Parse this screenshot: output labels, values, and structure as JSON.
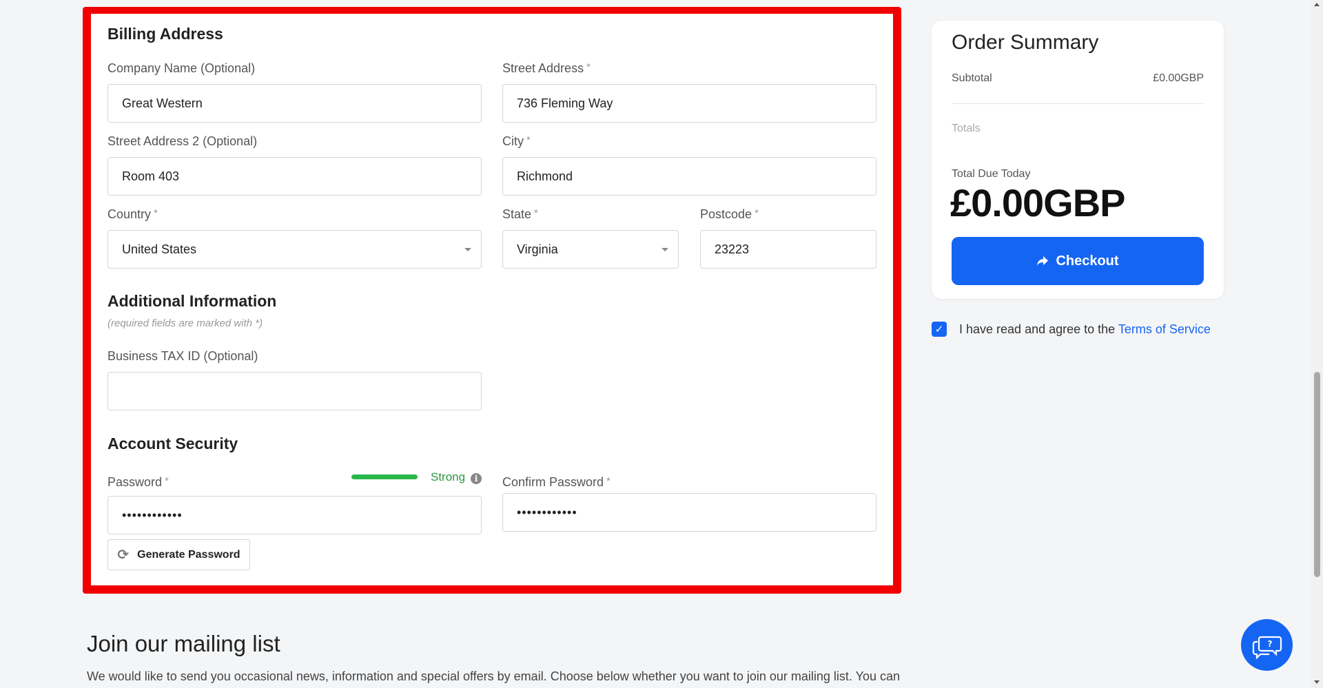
{
  "billing": {
    "title": "Billing Address",
    "company_label": "Company Name (Optional)",
    "company_value": "Great Western",
    "street_label": "Street Address",
    "street_value": "736 Fleming Way",
    "street2_label": "Street Address 2 (Optional)",
    "street2_value": "Room 403",
    "city_label": "City",
    "city_value": "Richmond",
    "country_label": "Country",
    "country_value": "United States",
    "state_label": "State",
    "state_value": "Virginia",
    "postcode_label": "Postcode",
    "postcode_value": "23223",
    "required_mark": "*"
  },
  "additional": {
    "title": "Additional Information",
    "hint": "(required fields are marked with *)",
    "tax_label": "Business TAX ID (Optional)",
    "tax_value": ""
  },
  "security": {
    "title": "Account Security",
    "password_label": "Password",
    "password_value": "••••••••••••",
    "strength_text": "Strong",
    "strength_fraction": 1.0,
    "confirm_label": "Confirm Password",
    "confirm_value": "••••••••••••",
    "generate_label": "Generate Password"
  },
  "summary": {
    "title": "Order Summary",
    "subtotal_label": "Subtotal",
    "subtotal_value": "£0.00GBP",
    "totals_label": "Totals",
    "due_label": "Total Due Today",
    "due_value": "£0.00GBP",
    "checkout_label": "Checkout"
  },
  "tos": {
    "text": "I have read and agree to the",
    "link": "Terms of Service",
    "checked": true
  },
  "mailing": {
    "title": "Join our mailing list",
    "text": "We would like to send you occasional news, information and special offers by email. Choose below whether you want to join our mailing list. You can"
  },
  "colors": {
    "accent": "#1565f3",
    "highlight_border": "#f00000",
    "strength": "#2ab84a"
  },
  "icons": {
    "refresh": "refresh-icon",
    "checkout": "share-arrow-icon",
    "chat": "chat-help-icon",
    "info": "info-icon"
  }
}
